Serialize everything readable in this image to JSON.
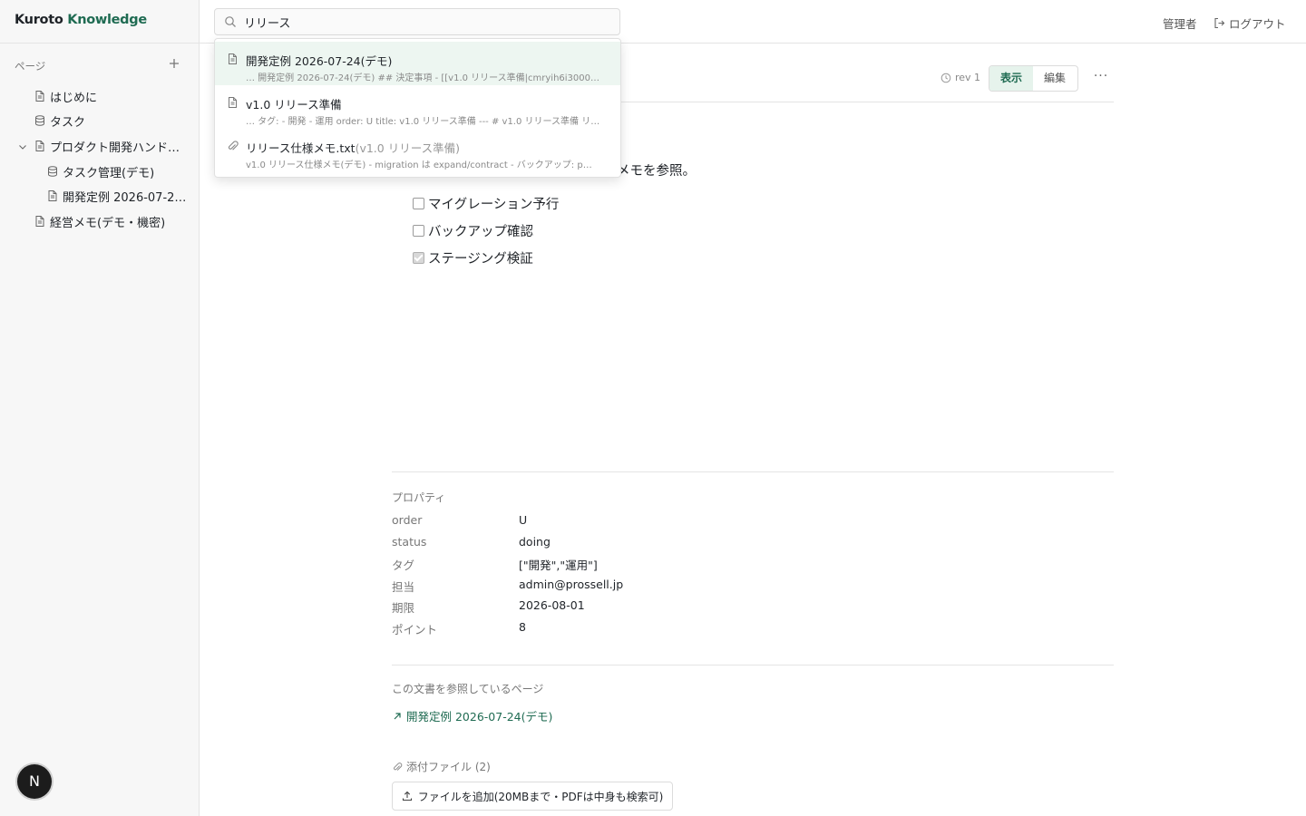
{
  "brand": {
    "name_part1": "Kuroto",
    "name_part2": "Knowledge"
  },
  "sidebar": {
    "section_label": "ページ",
    "add_icon": "plus-icon",
    "items": [
      {
        "label": "はじめに",
        "icon": "page-icon",
        "depth": 0
      },
      {
        "label": "タスク",
        "icon": "database-icon",
        "depth": 0
      },
      {
        "label": "プロダクト開発ハンド…",
        "icon": "page-icon",
        "depth": 0,
        "expanded": true
      },
      {
        "label": "タスク管理(デモ)",
        "icon": "database-icon",
        "depth": 1
      },
      {
        "label": "開発定例 2026-07-24…",
        "icon": "page-icon",
        "depth": 1
      },
      {
        "label": "経営メモ(デモ・機密)",
        "icon": "page-icon",
        "depth": 0
      }
    ],
    "avatar_letter": "N"
  },
  "header": {
    "search_value": "リリース",
    "admin_label": "管理者",
    "logout_label": "ログアウト"
  },
  "search_results": [
    {
      "icon": "page-icon",
      "title": "開発定例 2026-07-24(デモ)",
      "subtitle": "",
      "snippet": "… 開発定例 2026-07-24(デモ) ## 決定事項 - [[v1.0 リリース準備|cmryih6i3000…"
    },
    {
      "icon": "page-icon",
      "title": "v1.0 リリース準備",
      "subtitle": "",
      "snippet": "… タグ: - 開発 - 運用 order: U title: v1.0 リリース準備 --- # v1.0 リリース準備 リ…"
    },
    {
      "icon": "paperclip-icon",
      "title": "リリース仕様メモ.txt",
      "subtitle": "(v1.0 リリース準備)",
      "snippet": "v1.0 リリース仕様メモ(デモ) - migration は expand/contract - バックアップ: p…"
    }
  ],
  "doc": {
    "revision": "rev 1",
    "mode_view": "表示",
    "mode_edit": "編集",
    "more_label": "···",
    "visible_text_fragment": "メモを参照。",
    "checklist": [
      {
        "label": "マイグレーション予行",
        "checked": false
      },
      {
        "label": "バックアップ確認",
        "checked": false
      },
      {
        "label": "ステージング検証",
        "checked": true
      }
    ]
  },
  "properties": {
    "title": "プロパティ",
    "rows": [
      {
        "key": "order",
        "value": "U"
      },
      {
        "key": "status",
        "value": "doing"
      },
      {
        "key": "タグ",
        "value": "[\"開発\",\"運用\"]"
      },
      {
        "key": "担当",
        "value": "admin@prossell.jp"
      },
      {
        "key": "期限",
        "value": "2026-08-01"
      },
      {
        "key": "ポイント",
        "value": "8"
      }
    ]
  },
  "backlinks": {
    "title": "この文書を参照しているページ",
    "items": [
      "開発定例 2026-07-24(デモ)"
    ]
  },
  "attachments": {
    "title": "添付ファイル (2)",
    "upload_label": "ファイルを追加(20MBまで・PDFは中身も検索可)"
  },
  "colors": {
    "accent": "#1f6b52",
    "active_result_bg": "#edf6f1"
  }
}
